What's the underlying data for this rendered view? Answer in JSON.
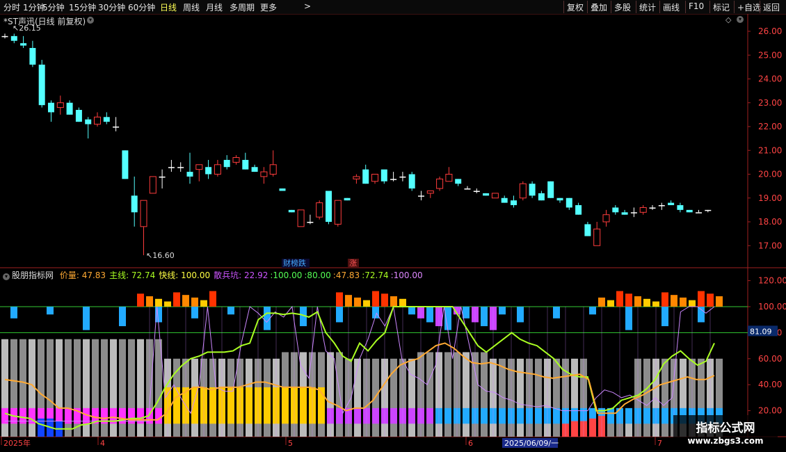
{
  "toolbar": {
    "timeframes": [
      "分时",
      "1分钟",
      "5分钟",
      "15分钟",
      "30分钟",
      "60分钟",
      "日线",
      "周线",
      "月线",
      "多周期",
      "更多"
    ],
    "active_timeframe": "日线",
    "more_arrow": ">",
    "right_buttons": [
      "复权",
      "叠加",
      "多股",
      "统计",
      "画线",
      "F10",
      "标记",
      "+自选",
      "返回"
    ]
  },
  "main_chart": {
    "title": "*ST声迅(日线 前复权)",
    "high_label": "26.15",
    "low_label": "16.60",
    "event_tags": [
      "财榜跌",
      "涨"
    ],
    "price_axis": [
      "26.00",
      "25.00",
      "24.00",
      "23.00",
      "22.00",
      "21.00",
      "20.00",
      "19.00",
      "18.00",
      "17.00"
    ],
    "up_color": "#ff3c3c",
    "down_color": "#54ffff"
  },
  "indicator": {
    "name": "股朋指标网",
    "fields": [
      {
        "label": "价量:",
        "value": "47.83",
        "color": "#ffaa33"
      },
      {
        "label": "主线:",
        "value": "72.74",
        "color": "#aaff22"
      },
      {
        "label": "快线:",
        "value": "100.00",
        "color": "#ffff44"
      },
      {
        "label": "散兵坑:",
        "value": "22.92",
        "color": "#cc55ff"
      }
    ],
    "trailing": [
      {
        "text": ":100.00",
        "color": "#55ff55"
      },
      {
        "text": ":80.00",
        "color": "#55ff55"
      },
      {
        "text": ":47.83",
        "color": "#ffaa33"
      },
      {
        "text": ":72.74",
        "color": "#aaff22"
      },
      {
        "text": ":100.00",
        "color": "#dd88ff"
      }
    ],
    "axis": [
      "120.00",
      "100.00",
      "80.00",
      "60.00",
      "40.00",
      "20.00"
    ],
    "cursor_value": "81.09"
  },
  "date_axis": {
    "labels": [
      "2025年",
      "4",
      "5",
      "6",
      "7"
    ],
    "cursor_date": "2025/06/09/一"
  },
  "watermark": {
    "line1": "指标公式网",
    "line2": "www.zbgs3.com"
  },
  "icons": {
    "collapse": "collapse-circle-icon",
    "diamond": "diamond-icon"
  },
  "candles": [
    [
      25.8,
      25.9,
      25.7,
      25.8
    ],
    [
      25.8,
      25.9,
      25.5,
      25.6
    ],
    [
      25.5,
      25.8,
      25.3,
      25.4
    ],
    [
      25.3,
      25.6,
      24.5,
      24.6
    ],
    [
      24.6,
      24.8,
      22.8,
      22.9
    ],
    [
      23.0,
      23.1,
      22.2,
      22.6
    ],
    [
      22.8,
      23.3,
      22.5,
      23.0
    ],
    [
      23.0,
      23.1,
      22.5,
      22.5
    ],
    [
      22.7,
      22.8,
      22.2,
      22.2
    ],
    [
      22.3,
      22.4,
      21.5,
      22.1
    ],
    [
      22.1,
      22.6,
      22.0,
      22.4
    ],
    [
      22.4,
      22.6,
      22.1,
      22.2
    ],
    [
      22.0,
      22.4,
      21.8,
      22.0
    ],
    [
      21.0,
      21.0,
      19.8,
      19.8
    ],
    [
      19.1,
      19.9,
      17.8,
      18.4
    ],
    [
      17.8,
      18.9,
      16.6,
      18.9
    ],
    [
      19.2,
      19.9,
      19.2,
      19.9
    ],
    [
      19.9,
      20.2,
      19.4,
      19.9
    ],
    [
      20.3,
      20.6,
      20.1,
      20.3
    ],
    [
      20.3,
      20.5,
      20.1,
      20.3
    ],
    [
      20.1,
      20.9,
      19.6,
      19.9
    ],
    [
      20.2,
      20.4,
      19.7,
      20.4
    ],
    [
      20.3,
      20.6,
      19.8,
      20.0
    ],
    [
      20.0,
      20.6,
      19.9,
      20.4
    ],
    [
      20.6,
      20.8,
      20.2,
      20.3
    ],
    [
      20.5,
      20.8,
      20.4,
      20.7
    ],
    [
      20.6,
      20.9,
      20.2,
      20.2
    ],
    [
      20.3,
      20.4,
      20.1,
      20.1
    ],
    [
      19.9,
      20.3,
      19.6,
      20.1
    ],
    [
      20.0,
      21.0,
      19.9,
      20.4
    ],
    [
      19.4,
      19.4,
      19.3,
      19.3
    ],
    [
      18.5,
      18.5,
      18.4,
      18.4
    ],
    [
      17.8,
      18.5,
      17.8,
      18.5
    ],
    [
      18.0,
      18.3,
      17.9,
      18.0
    ],
    [
      18.2,
      18.9,
      18.1,
      18.8
    ],
    [
      19.3,
      19.3,
      17.9,
      18.0
    ],
    [
      17.9,
      18.9,
      17.8,
      18.9
    ],
    [
      19.0,
      19.0,
      18.9,
      18.9
    ],
    [
      19.8,
      20.0,
      19.6,
      19.9
    ],
    [
      20.2,
      20.4,
      19.6,
      19.6
    ],
    [
      19.7,
      20.0,
      19.6,
      20.0
    ],
    [
      20.2,
      20.1,
      19.6,
      19.7
    ],
    [
      19.8,
      20.1,
      19.7,
      19.8
    ],
    [
      19.9,
      20.1,
      19.7,
      19.9
    ],
    [
      20.0,
      20.1,
      19.3,
      19.4
    ],
    [
      19.1,
      19.3,
      18.9,
      19.1
    ],
    [
      19.2,
      19.3,
      19.0,
      19.3
    ],
    [
      19.4,
      19.9,
      19.3,
      19.8
    ],
    [
      19.7,
      20.3,
      19.7,
      20.0
    ],
    [
      19.8,
      19.8,
      19.5,
      19.6
    ],
    [
      19.4,
      19.5,
      19.4,
      19.4
    ],
    [
      19.3,
      19.4,
      19.2,
      19.3
    ],
    [
      19.2,
      19.2,
      19.1,
      19.1
    ],
    [
      19.0,
      19.2,
      19.0,
      19.2
    ],
    [
      19.0,
      19.1,
      18.8,
      18.8
    ],
    [
      18.9,
      19.1,
      18.6,
      18.7
    ],
    [
      19.0,
      19.7,
      18.9,
      19.6
    ],
    [
      19.6,
      19.7,
      19.0,
      19.1
    ],
    [
      19.2,
      19.3,
      18.9,
      18.9
    ],
    [
      19.7,
      19.7,
      19.0,
      19.0
    ],
    [
      19.0,
      19.0,
      18.8,
      18.9
    ],
    [
      19.0,
      19.0,
      18.5,
      18.6
    ],
    [
      18.7,
      18.8,
      18.3,
      18.3
    ],
    [
      17.9,
      18.0,
      17.4,
      17.4
    ],
    [
      17.0,
      18.0,
      17.0,
      17.7
    ],
    [
      18.0,
      18.5,
      17.8,
      18.3
    ],
    [
      18.6,
      18.7,
      18.3,
      18.4
    ],
    [
      18.4,
      18.5,
      18.3,
      18.3
    ],
    [
      18.4,
      18.6,
      18.2,
      18.4
    ],
    [
      18.4,
      18.7,
      18.3,
      18.6
    ],
    [
      18.6,
      18.7,
      18.5,
      18.6
    ],
    [
      18.7,
      18.8,
      18.5,
      18.7
    ],
    [
      18.8,
      18.9,
      18.7,
      18.7
    ],
    [
      18.7,
      18.8,
      18.4,
      18.5
    ],
    [
      18.5,
      18.5,
      18.4,
      18.4
    ],
    [
      18.4,
      18.5,
      18.4,
      18.4
    ],
    [
      18.5,
      18.5,
      18.4,
      18.5
    ]
  ],
  "lines": {
    "price_volume": [
      44,
      43,
      42,
      40,
      33,
      28,
      22,
      22,
      20,
      17,
      15,
      14,
      15,
      14,
      13,
      13,
      13,
      13,
      18,
      30,
      34,
      38,
      38,
      36,
      38,
      38,
      38,
      40,
      42,
      42,
      40,
      38,
      38,
      38,
      38,
      36,
      27,
      24,
      20,
      22,
      22,
      28,
      38,
      48,
      55,
      58,
      60,
      65,
      70,
      72,
      68,
      62,
      57,
      56,
      57,
      55,
      52,
      50,
      49,
      48,
      46,
      45,
      46,
      47,
      48,
      44,
      18,
      18,
      18,
      25,
      29,
      32,
      36,
      40,
      42,
      44,
      46,
      44,
      44,
      47
    ],
    "main": [
      18,
      16,
      15,
      14,
      10,
      8,
      6,
      6,
      6,
      9,
      10,
      12,
      12,
      12,
      13,
      14,
      14,
      16,
      26,
      38,
      48,
      55,
      60,
      62,
      65,
      65,
      65,
      66,
      70,
      72,
      90,
      95,
      95,
      94,
      95,
      94,
      92,
      96,
      80,
      72,
      62,
      58,
      72,
      66,
      74,
      80,
      100,
      100,
      100,
      100,
      100,
      100,
      100,
      100,
      90,
      80,
      70,
      65,
      70,
      75,
      80,
      75,
      72,
      70,
      65,
      60,
      52,
      48,
      46,
      46,
      20,
      20,
      22,
      28,
      30,
      32,
      37,
      44,
      56,
      62,
      66,
      60,
      55,
      58,
      72
    ],
    "scatter": [
      12,
      12,
      12,
      12,
      12,
      12,
      12,
      12,
      12,
      12,
      12,
      12,
      12,
      12,
      12,
      12,
      12,
      12,
      100,
      30,
      40,
      28,
      18,
      40,
      100,
      38,
      35,
      35,
      72,
      100,
      95,
      88,
      96,
      92,
      100,
      55,
      45,
      100,
      66,
      60,
      18,
      30,
      60,
      75,
      95,
      85,
      100,
      60,
      48,
      45,
      40,
      55,
      100,
      60,
      100,
      70,
      40,
      35,
      34,
      30,
      28,
      25,
      24,
      23,
      24,
      22,
      20,
      20,
      20,
      20,
      30,
      36,
      34,
      30,
      32,
      28,
      24,
      30,
      24,
      30,
      96,
      100,
      100,
      95,
      100
    ]
  }
}
